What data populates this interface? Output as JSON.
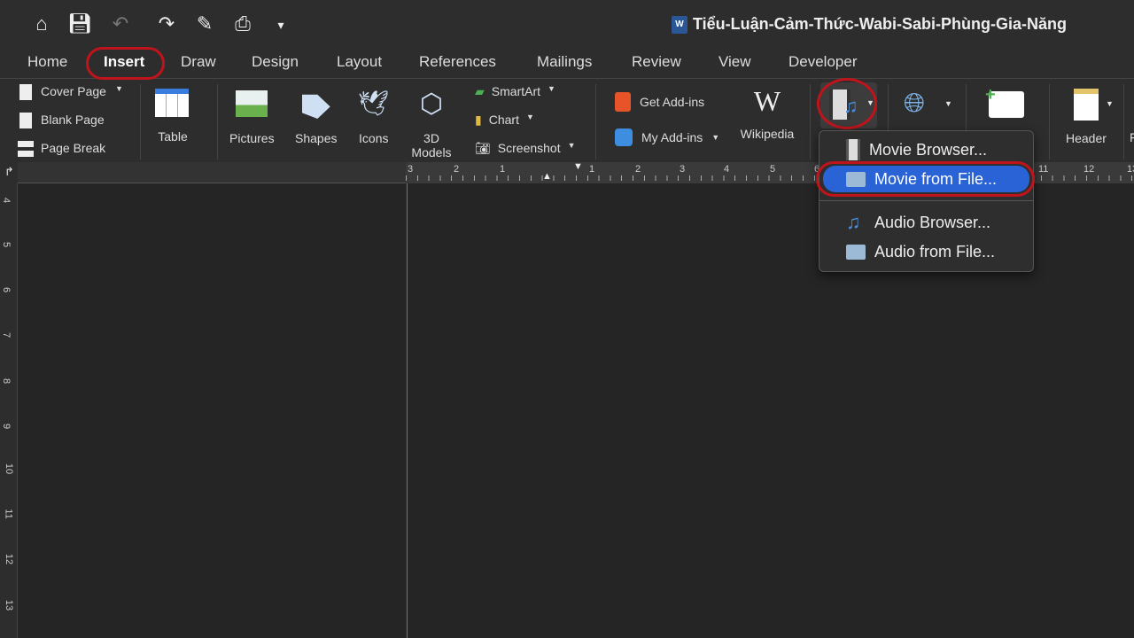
{
  "quick_access": {
    "icons": [
      "home-icon",
      "save-icon",
      "undo-icon",
      "redo-icon",
      "edit-document-icon",
      "print-icon",
      "customize-toolbar-icon"
    ]
  },
  "window": {
    "title": "Tiểu-Luận-Cảm-Thức-Wabi-Sabi-Phùng-Gia-Năng",
    "app_badge": "W"
  },
  "tabs": [
    {
      "label": "Home"
    },
    {
      "label": "Insert",
      "active": true
    },
    {
      "label": "Draw"
    },
    {
      "label": "Design"
    },
    {
      "label": "Layout"
    },
    {
      "label": "References"
    },
    {
      "label": "Mailings"
    },
    {
      "label": "Review"
    },
    {
      "label": "View"
    },
    {
      "label": "Developer"
    }
  ],
  "ribbon": {
    "pages": {
      "cover": "Cover Page",
      "blank": "Blank Page",
      "break": "Page Break"
    },
    "table": "Table",
    "pictures": "Pictures",
    "shapes": "Shapes",
    "icons": "Icons",
    "models": "3D Models",
    "smartart": "SmartArt",
    "chart": "Chart",
    "screenshot": "Screenshot",
    "get_addins": "Get Add-ins",
    "my_addins": "My Add-ins",
    "wikipedia": "Wikipedia",
    "wiki_glyph": "W",
    "comment_partial": "t",
    "header": "Header",
    "footer_partial": "F"
  },
  "media_menu": {
    "items": [
      {
        "label": "Movie Browser...",
        "icon": "film-icon"
      },
      {
        "label": "Movie from File...",
        "icon": "folder-icon",
        "selected": true
      },
      {
        "label": "Audio Browser...",
        "icon": "music-note-icon"
      },
      {
        "label": "Audio from File...",
        "icon": "folder-icon"
      }
    ]
  },
  "ruler": {
    "horizontal": [
      "3",
      "2",
      "1",
      "1",
      "2",
      "3",
      "4",
      "5",
      "6",
      "11",
      "12",
      "13"
    ],
    "vertical": [
      "4",
      "5",
      "6",
      "7",
      "8",
      "9",
      "10",
      "11",
      "12",
      "13"
    ]
  },
  "colors": {
    "highlight": "#c0141c",
    "selection": "#2a63d6"
  }
}
